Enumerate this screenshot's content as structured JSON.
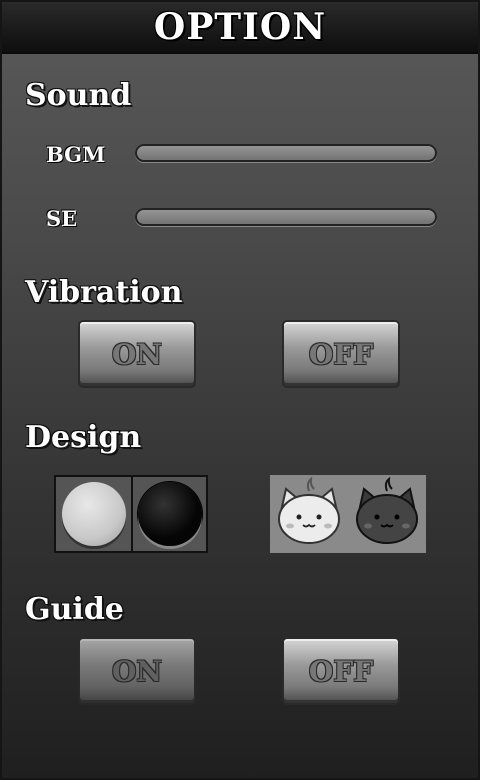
{
  "header": {
    "title": "OPTION"
  },
  "sound": {
    "heading": "Sound",
    "bgm_label": "BGM",
    "se_label": "SE"
  },
  "vibration": {
    "heading": "Vibration",
    "on_label": "ON",
    "off_label": "OFF"
  },
  "design": {
    "heading": "Design",
    "options": [
      {
        "name": "stone-theme",
        "icons": [
          "white-stone-icon",
          "black-stone-icon"
        ]
      },
      {
        "name": "cat-theme",
        "icons": [
          "white-cat-icon",
          "black-cat-icon"
        ]
      }
    ]
  },
  "guide": {
    "heading": "Guide",
    "on_label": "ON",
    "off_label": "OFF"
  }
}
